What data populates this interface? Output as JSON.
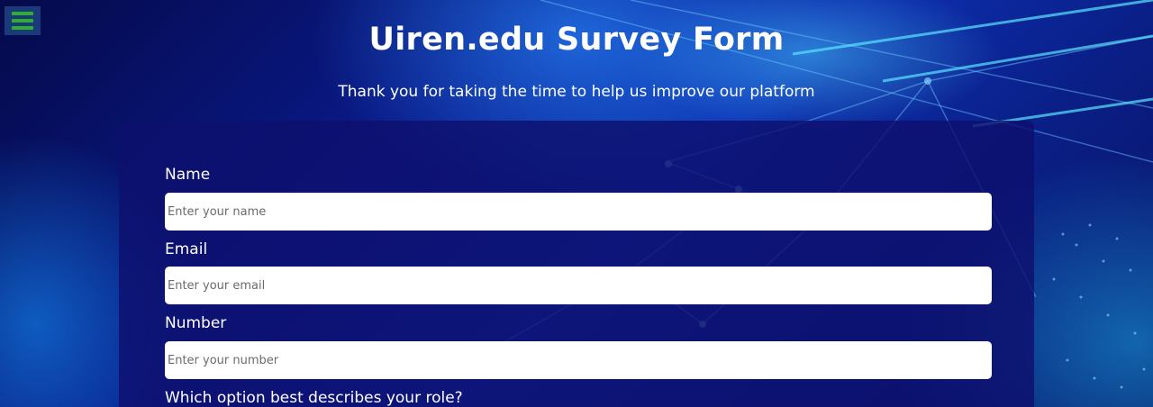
{
  "header": {
    "title": "Uiren.edu Survey Form",
    "subtitle": "Thank you for taking the time to help us improve our platform"
  },
  "menu": {
    "icon": "hamburger-menu-icon",
    "icon_color": "#2fae2f"
  },
  "form": {
    "fields": [
      {
        "label": "Name",
        "placeholder": "Enter your name",
        "value": ""
      },
      {
        "label": "Email",
        "placeholder": "Enter your email",
        "value": ""
      },
      {
        "label": "Number",
        "placeholder": "Enter your number",
        "value": ""
      }
    ],
    "role_question": "Which option best describes your role?"
  },
  "colors": {
    "background": "#0a1a8a",
    "card": "#0e106e",
    "text": "#ffffff",
    "input_bg": "#ffffff"
  }
}
